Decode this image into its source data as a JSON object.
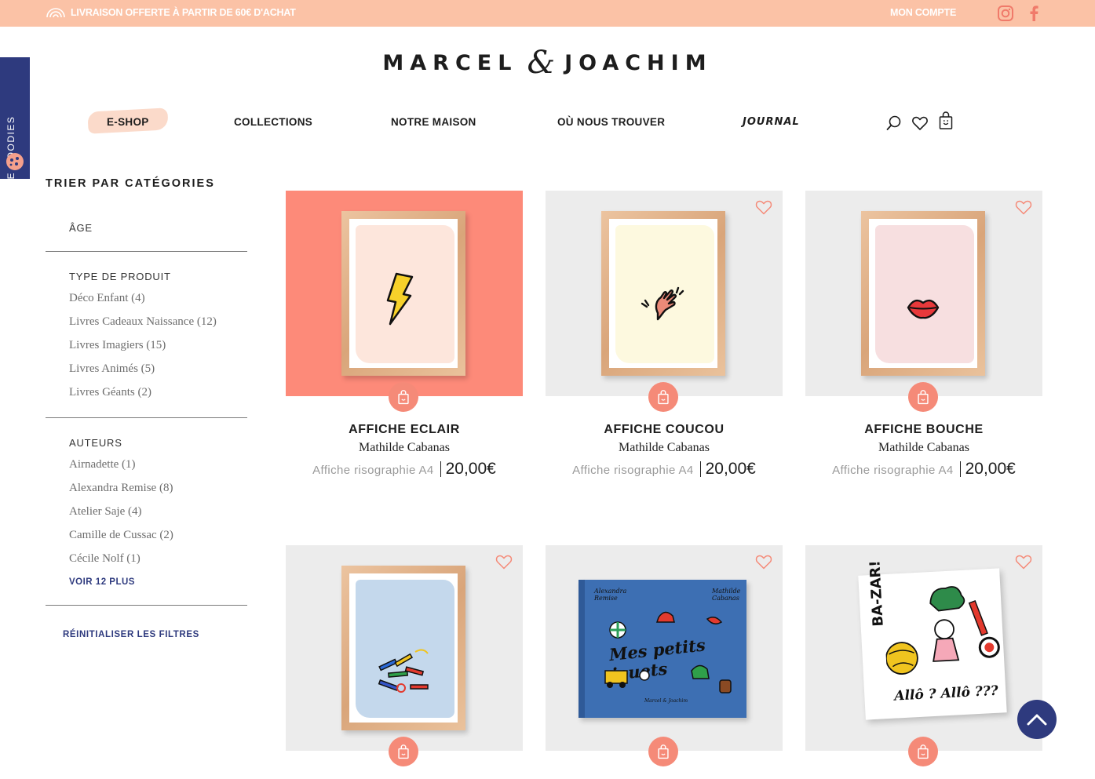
{
  "topbar": {
    "promo_text": "LIVRAISON OFFERTE À PARTIR DE 60€ D'ACHAT",
    "account_label": "MON COMPTE",
    "bg_color": "#fbc2a6"
  },
  "goodies_tab": {
    "label": "FREE GOODIES",
    "color": "#2e3a7e"
  },
  "logo": {
    "left": "MARCEL",
    "amp": "&",
    "right": "JOACHIM"
  },
  "nav": {
    "items": [
      {
        "label": "E-SHOP"
      },
      {
        "label": "COLLECTIONS"
      },
      {
        "label": "NOTRE MAISON"
      },
      {
        "label": "OÙ NOUS TROUVER"
      },
      {
        "label": "JOURNAL"
      }
    ],
    "icons": [
      "search-icon",
      "heart-icon",
      "bag-icon"
    ]
  },
  "sidebar": {
    "title": "TRIER PAR CATÉGORIES",
    "age_label": "ÂGE",
    "product_type": {
      "label": "TYPE DE PRODUIT",
      "options": [
        "Déco Enfant (4)",
        "Livres Cadeaux Naissance (12)",
        "Livres Imagiers (15)",
        "Livres Animés (5)",
        "Livres Géants (2)"
      ]
    },
    "authors": {
      "label": "AUTEURS",
      "options": [
        "Airnadette (1)",
        "Alexandra Remise (8)",
        "Atelier Saje (4)",
        "Camille de Cussac (2)",
        "Cécile Nolf (1)"
      ],
      "more_label": "VOIR 12 PLUS"
    },
    "reset_label": "RÉINITIALISER LES FILTRES"
  },
  "products": [
    {
      "title": "AFFICHE ECLAIR",
      "author": "Mathilde Cabanas",
      "type": "Affiche risographie A4",
      "price": "20,00€"
    },
    {
      "title": "AFFICHE COUCOU",
      "author": "Mathilde Cabanas",
      "type": "Affiche risographie A4",
      "price": "20,00€"
    },
    {
      "title": "AFFICHE BOUCHE",
      "author": "Mathilde Cabanas",
      "type": "Affiche risographie A4",
      "price": "20,00€"
    }
  ],
  "book_cover": {
    "title": "Mes petits jouets",
    "author_left": "Alexandra Remise",
    "author_right": "Mathilde Cabanas",
    "publisher": "Marcel & Joachim"
  },
  "bazar_cover": {
    "title": "BA-ZAR!",
    "caption": "Allô ? Allô ???"
  },
  "colors": {
    "accent": "#f58a78",
    "navy": "#2e3a7e",
    "coral_bg": "#fd8a79",
    "card_bg": "#ececec"
  }
}
